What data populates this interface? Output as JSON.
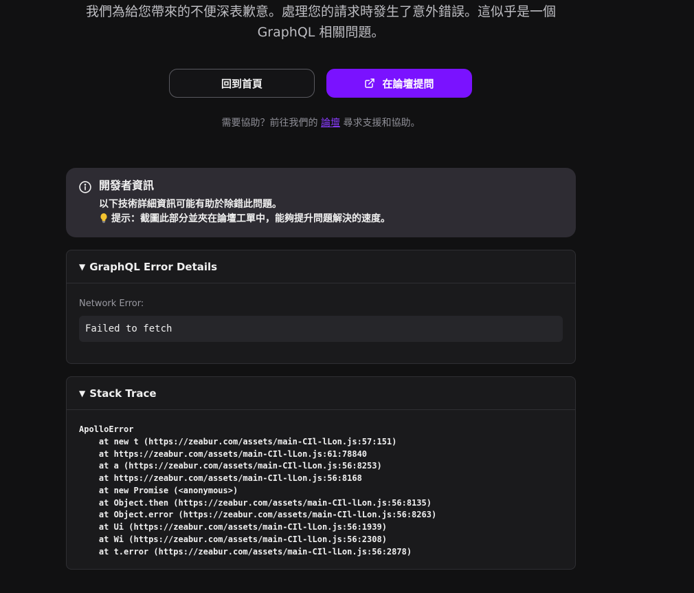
{
  "intro": {
    "line1": "我們為給您帶來的不便深表歉意。處理您的請求時發生了意外錯誤。這似乎是一個",
    "line2": "GraphQL 相關問題。"
  },
  "buttons": {
    "home_label": "回到首頁",
    "forum_label": "在論壇提問"
  },
  "help": {
    "prefix": "需要協助？前往我們的 ",
    "link_text": "論壇",
    "suffix": " 尋求支援和協助。"
  },
  "dev_info": {
    "title": "開發者資訊",
    "line1": "以下技術詳細資訊可能有助於除錯此問題。",
    "line2": "提示：截圖此部分並夾在論壇工單中，能夠提升問題解決的速度。",
    "accent_color": "#7a12ff"
  },
  "graphql_panel": {
    "title": "GraphQL Error Details",
    "network_label": "Network Error:",
    "network_value": "Failed to fetch"
  },
  "stack_panel": {
    "title": "Stack Trace",
    "lines": [
      "ApolloError",
      "    at new t (https://zeabur.com/assets/main-CIl-lLon.js:57:151)",
      "    at https://zeabur.com/assets/main-CIl-lLon.js:61:78840",
      "    at a (https://zeabur.com/assets/main-CIl-lLon.js:56:8253)",
      "    at https://zeabur.com/assets/main-CIl-lLon.js:56:8168",
      "    at new Promise (<anonymous>)",
      "    at Object.then (https://zeabur.com/assets/main-CIl-lLon.js:56:8135)",
      "    at Object.error (https://zeabur.com/assets/main-CIl-lLon.js:56:8263)",
      "    at Ui (https://zeabur.com/assets/main-CIl-lLon.js:56:1939)",
      "    at Wi (https://zeabur.com/assets/main-CIl-lLon.js:56:2308)",
      "    at t.error (https://zeabur.com/assets/main-CIl-lLon.js:56:2878)"
    ]
  },
  "icons": {
    "forum_button": "external-link-icon",
    "dev_info": "info-circle-icon",
    "hint": "lightbulb-icon",
    "panel_toggle": "triangle-down-icon"
  }
}
